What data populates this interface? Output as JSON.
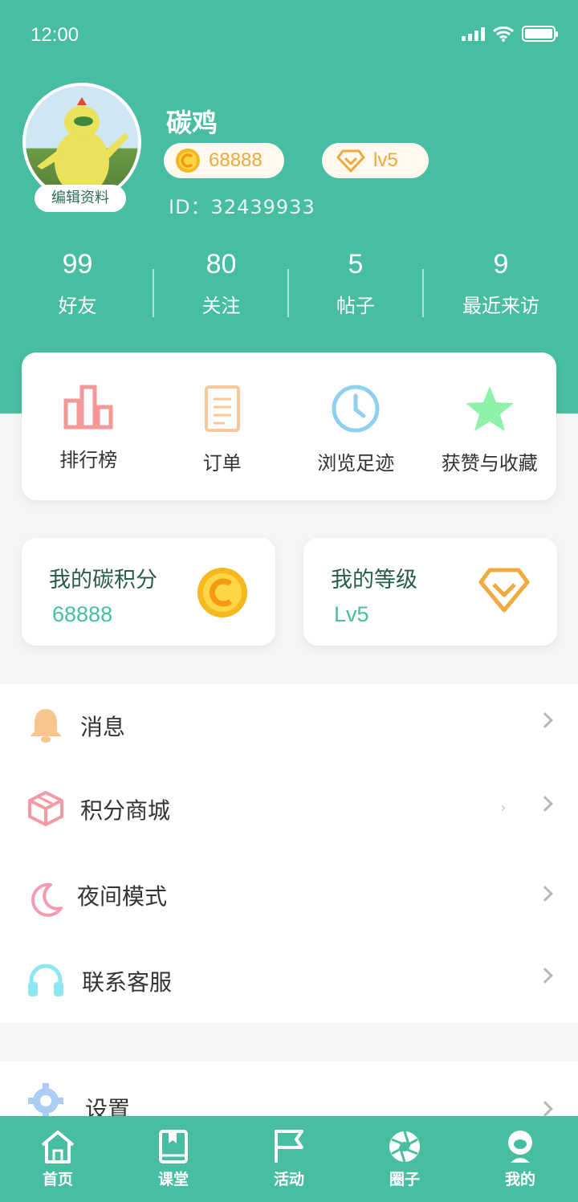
{
  "status_bar": {
    "time": "12:00"
  },
  "profile": {
    "username": "碳鸡",
    "edit_label": "编辑资料",
    "coins": "68888",
    "level_badge": "lv5",
    "user_id": "ID：32439933"
  },
  "stats": [
    {
      "value": "99",
      "label": "好友"
    },
    {
      "value": "80",
      "label": "关注"
    },
    {
      "value": "5",
      "label": "帖子"
    },
    {
      "value": "9",
      "label": "最近来访"
    }
  ],
  "quick_actions": [
    {
      "label": "排行榜",
      "icon": "bar-chart-icon",
      "color": "#f29a9a"
    },
    {
      "label": "订单",
      "icon": "document-icon",
      "color": "#f8c79a"
    },
    {
      "label": "浏览足迹",
      "icon": "clock-icon",
      "color": "#8fd0f0"
    },
    {
      "label": "获赞与收藏",
      "icon": "star-icon",
      "color": "#8ef3a8"
    }
  ],
  "points_card": {
    "title": "我的碳积分",
    "value": "68888",
    "icon": "coin-icon"
  },
  "level_card": {
    "title": "我的等级",
    "value": "Lv5",
    "icon": "diamond-icon"
  },
  "menu": [
    {
      "label": "消息",
      "icon": "bell-icon",
      "color": "#f7c68e"
    },
    {
      "label": "积分商城",
      "icon": "box-icon",
      "color": "#f59aa5"
    },
    {
      "label": "夜间模式",
      "icon": "moon-icon",
      "color": "#f49bb0"
    },
    {
      "label": "联系客服",
      "icon": "headphones-icon",
      "color": "#8fe6f3"
    }
  ],
  "settings": {
    "label": "设置",
    "icon": "gear-icon",
    "color": "#a9cdf3"
  },
  "tabbar": [
    {
      "label": "首页",
      "icon": "home-icon"
    },
    {
      "label": "课堂",
      "icon": "book-icon"
    },
    {
      "label": "活动",
      "icon": "flag-icon"
    },
    {
      "label": "圈子",
      "icon": "aperture-icon"
    },
    {
      "label": "我的",
      "icon": "user-icon"
    }
  ],
  "colors": {
    "primary": "#47bda2",
    "coin": "#f5b821",
    "level": "#f0a93c"
  }
}
